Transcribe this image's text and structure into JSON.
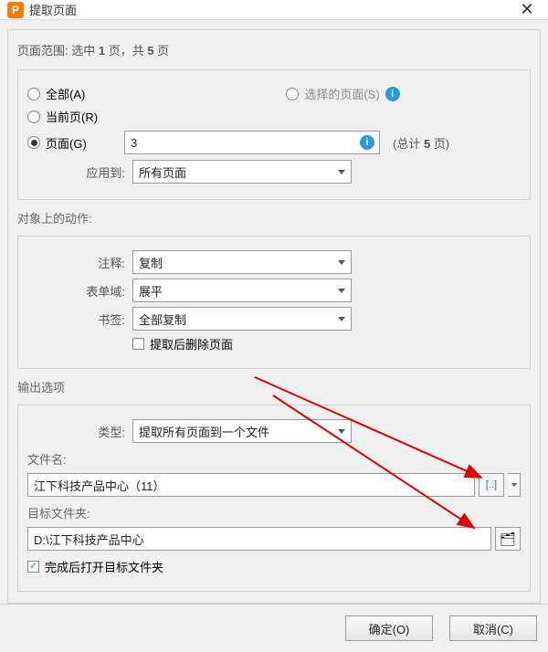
{
  "titlebar": {
    "icon_letter": "P",
    "title": "提取页面",
    "close_glyph": "✕"
  },
  "page_range": {
    "summary_prefix": "页面范围: 选中 ",
    "selected_count": "1",
    "summary_mid": " 页，共 ",
    "total_count": "5",
    "summary_suffix": " 页",
    "opt_all": "全部(A)",
    "opt_current": "当前页(R)",
    "opt_pages": "页面(G)",
    "opt_selected": "选择的页面(S)",
    "pages_value": "3",
    "total_text_prefix": "(总计 ",
    "total_text_value": "5",
    "total_text_suffix": " 页)",
    "apply_to_label": "应用到:",
    "apply_to_value": "所有页面"
  },
  "actions": {
    "header": "对象上的动作:",
    "annot_label": "注释:",
    "annot_value": "复制",
    "form_label": "表单域:",
    "form_value": "展平",
    "bookmark_label": "书签:",
    "bookmark_value": "全部复制",
    "delete_after": "提取后删除页面"
  },
  "output": {
    "header": "输出选项",
    "type_label": "类型:",
    "type_value": "提取所有页面到一个文件",
    "filename_label": "文件名:",
    "filename_value": "江下科技产品中心（11）",
    "folder_label": "目标文件夹:",
    "folder_value": "D:\\江下科技产品中心",
    "browse_glyph": "[..]",
    "folder_glyph": "🗂",
    "open_after": "完成后打开目标文件夹"
  },
  "footer": {
    "ok": "确定(O)",
    "cancel": "取消(C)"
  }
}
